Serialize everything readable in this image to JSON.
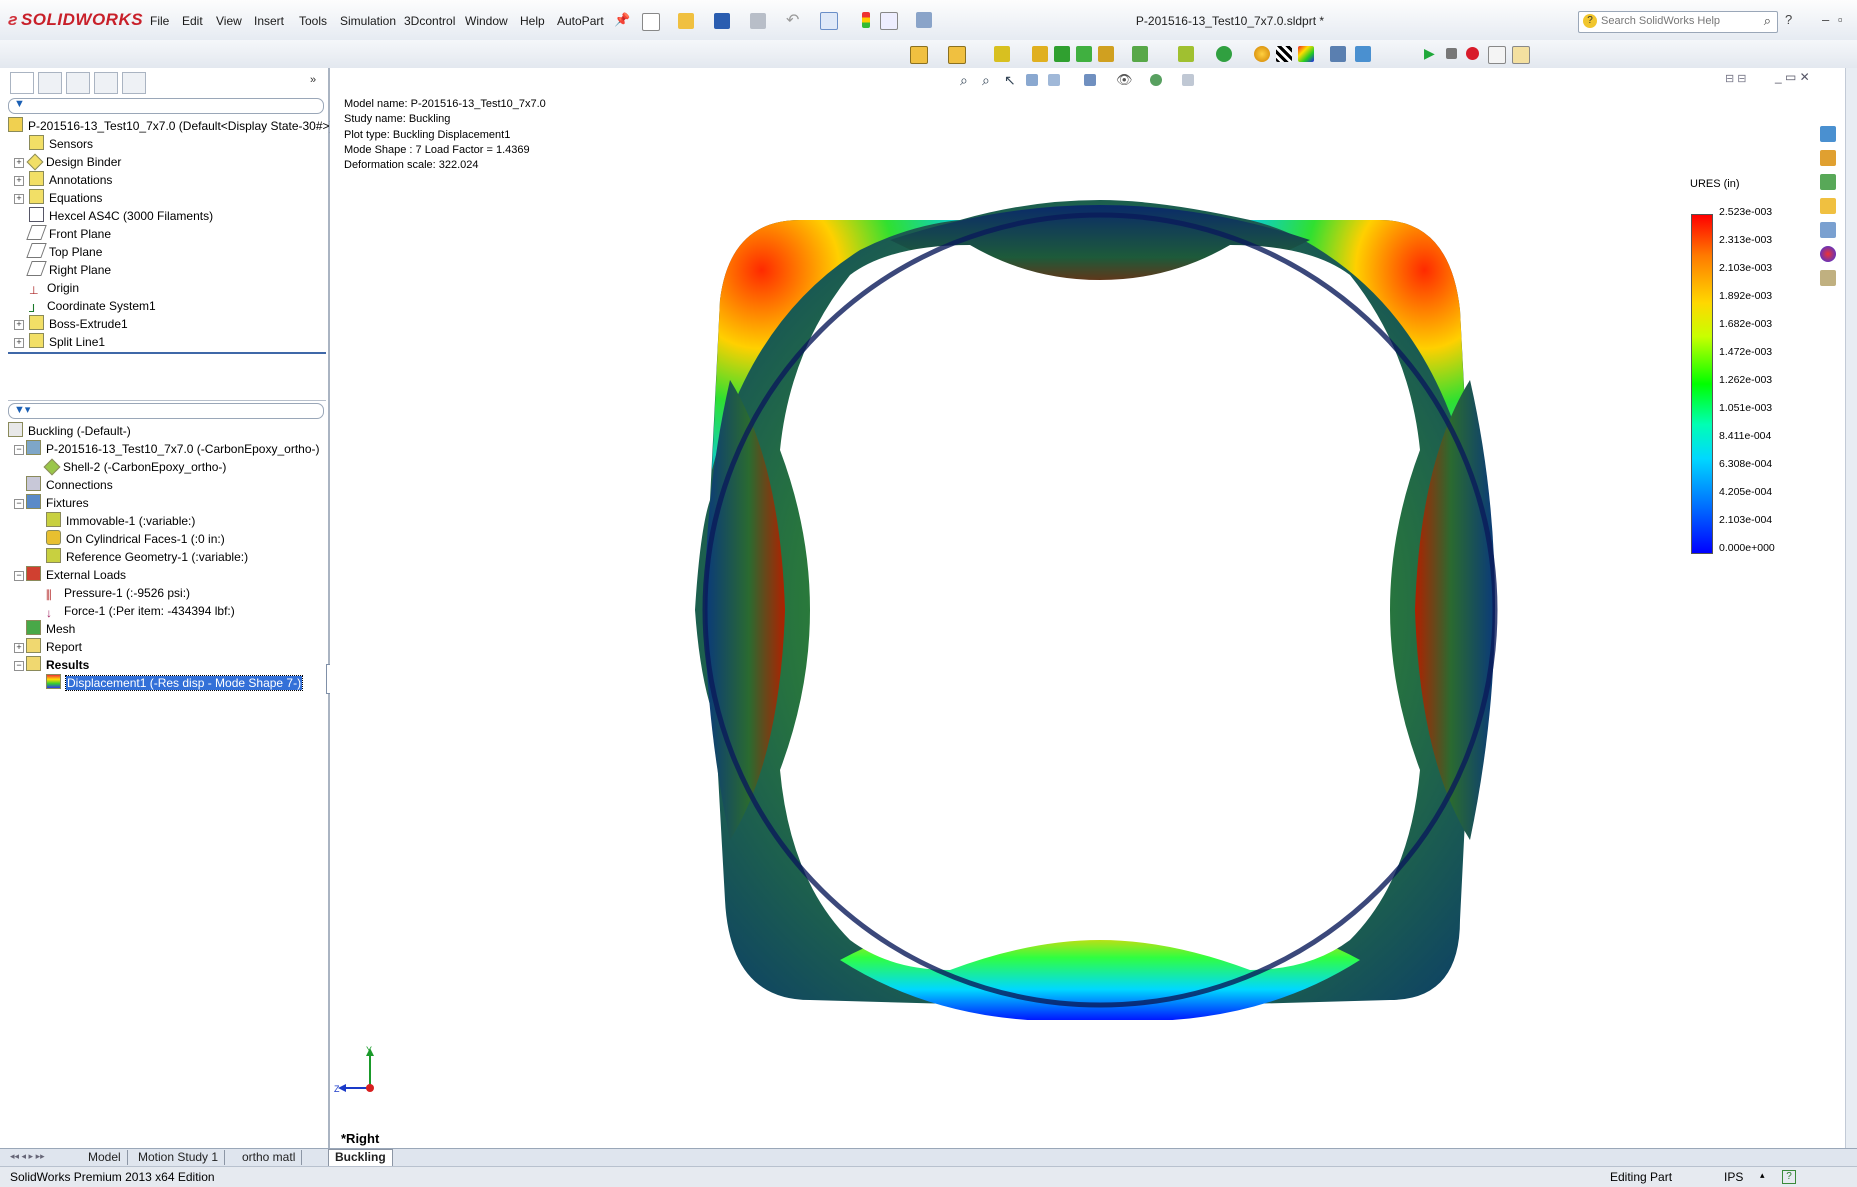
{
  "app": {
    "brand": "SOLIDWORKS",
    "document_title": "P-201516-13_Test10_7x7.0.sldprt *"
  },
  "menu": [
    "File",
    "Edit",
    "View",
    "Insert",
    "Tools",
    "Simulation",
    "3Dcontrol",
    "Window",
    "Help",
    "AutoPart"
  ],
  "search": {
    "placeholder": "Search SolidWorks Help"
  },
  "feature_tree": {
    "root": "P-201516-13_Test10_7x7.0  (Default<Display State-30#>)",
    "items": [
      {
        "label": "Sensors",
        "icon": "sensors-icon",
        "expandable": false
      },
      {
        "label": "Design Binder",
        "icon": "design-binder-icon",
        "expandable": true
      },
      {
        "label": "Annotations",
        "icon": "annotations-icon",
        "expandable": true
      },
      {
        "label": "Equations",
        "icon": "equations-icon",
        "expandable": true
      },
      {
        "label": "Hexcel AS4C (3000 Filaments)",
        "icon": "material-icon",
        "expandable": false
      },
      {
        "label": "Front Plane",
        "icon": "plane-icon",
        "expandable": false
      },
      {
        "label": "Top Plane",
        "icon": "plane-icon",
        "expandable": false
      },
      {
        "label": "Right Plane",
        "icon": "plane-icon",
        "expandable": false
      },
      {
        "label": "Origin",
        "icon": "origin-icon",
        "expandable": false
      },
      {
        "label": "Coordinate System1",
        "icon": "coordinate-system-icon",
        "expandable": false
      },
      {
        "label": "Boss-Extrude1",
        "icon": "extrude-icon",
        "expandable": true
      },
      {
        "label": "Split Line1",
        "icon": "split-line-icon",
        "expandable": true
      }
    ]
  },
  "sim_tree": {
    "root": "Buckling (-Default-)",
    "items": [
      {
        "label": "P-201516-13_Test10_7x7.0 (-CarbonEpoxy_ortho-)",
        "level": 1,
        "expandable": true
      },
      {
        "label": "Shell-2 (-CarbonEpoxy_ortho-)",
        "level": 2,
        "expandable": false
      },
      {
        "label": "Connections",
        "level": 1,
        "expandable": false
      },
      {
        "label": "Fixtures",
        "level": 1,
        "expandable": true
      },
      {
        "label": "Immovable-1 (:variable:)",
        "level": 2,
        "expandable": false
      },
      {
        "label": "On Cylindrical Faces-1 (:0 in:)",
        "level": 2,
        "expandable": false
      },
      {
        "label": "Reference Geometry-1 (:variable:)",
        "level": 2,
        "expandable": false
      },
      {
        "label": "External Loads",
        "level": 1,
        "expandable": true
      },
      {
        "label": "Pressure-1 (:-9526 psi:)",
        "level": 2,
        "expandable": false
      },
      {
        "label": "Force-1 (:Per item: -434394 lbf:)",
        "level": 2,
        "expandable": false
      },
      {
        "label": "Mesh",
        "level": 1,
        "expandable": false
      },
      {
        "label": "Report",
        "level": 1,
        "expandable": true
      },
      {
        "label": "Results",
        "level": 1,
        "expandable": true,
        "bold": true
      },
      {
        "label": "Displacement1 (-Res disp - Mode Shape 7-)",
        "level": 2,
        "expandable": false,
        "selected": true
      }
    ]
  },
  "plot_info": {
    "model_name": "Model name: P-201516-13_Test10_7x7.0",
    "study_name": "Study name: Buckling",
    "plot_type": "Plot type: Buckling Displacement1",
    "mode_shape": "Mode Shape : 7  Load Factor = 1.4369",
    "deformation": "Deformation scale: 322.024"
  },
  "legend": {
    "title": "URES (in)",
    "values": [
      "2.523e-003",
      "2.313e-003",
      "2.103e-003",
      "1.892e-003",
      "1.682e-003",
      "1.472e-003",
      "1.262e-003",
      "1.051e-003",
      "8.411e-004",
      "6.308e-004",
      "4.205e-004",
      "2.103e-004",
      "0.000e+000"
    ]
  },
  "view": {
    "label": "*Right",
    "triad_y": "Y",
    "triad_z": "Z"
  },
  "bottom_tabs": [
    {
      "label": "Model",
      "active": false
    },
    {
      "label": "Motion Study 1",
      "active": false
    },
    {
      "label": "ortho matl",
      "active": false
    },
    {
      "label": "Buckling",
      "active": true
    }
  ],
  "status": {
    "left": "SolidWorks Premium 2013 x64 Edition",
    "mode": "Editing Part",
    "units": "IPS"
  },
  "colors": {
    "selection": "#3370d8",
    "tree_separator": "#3f68a8",
    "brand_red": "#c8202a"
  }
}
